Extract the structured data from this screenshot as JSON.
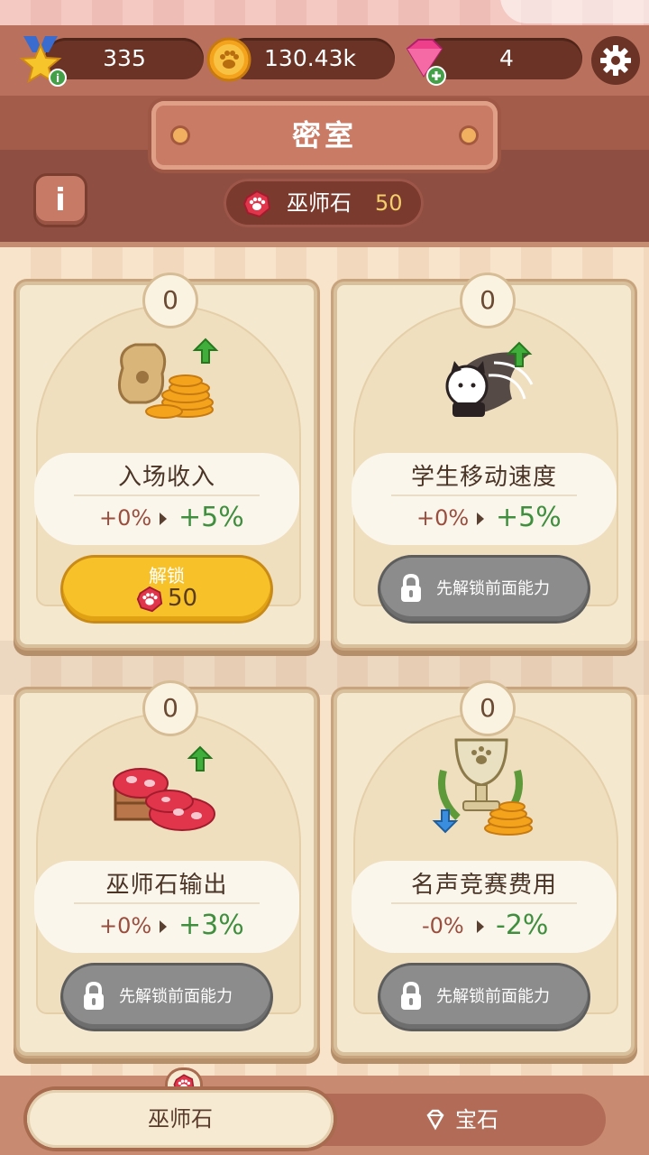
{
  "resources": {
    "level": "335",
    "coins": "130.43k",
    "gems": "4"
  },
  "title": "密室",
  "wizard_stone": {
    "label": "巫师石",
    "count": "50"
  },
  "cards": [
    {
      "name": "入场收入",
      "level": "0",
      "old_value": "+0%",
      "new_value": "+5%",
      "button": {
        "type": "unlock",
        "label": "解锁",
        "cost": "50"
      },
      "trend": "up",
      "icon": "coin-bag-icon"
    },
    {
      "name": "学生移动速度",
      "level": "0",
      "old_value": "+0%",
      "new_value": "+5%",
      "button": {
        "type": "locked",
        "label": "先解锁前面能力"
      },
      "trend": "up",
      "icon": "running-cat-icon"
    },
    {
      "name": "巫师石输出",
      "level": "0",
      "old_value": "+0%",
      "new_value": "+3%",
      "button": {
        "type": "locked",
        "label": "先解锁前面能力"
      },
      "trend": "up",
      "icon": "wizard-stone-pile-icon"
    },
    {
      "name": "名声竞赛费用",
      "level": "0",
      "old_value": "-0%",
      "new_value": "-2%",
      "button": {
        "type": "locked",
        "label": "先解锁前面能力"
      },
      "trend": "down",
      "icon": "trophy-icon"
    }
  ],
  "tabs": [
    {
      "label": "巫师石",
      "active": true
    },
    {
      "label": "宝石",
      "active": false
    }
  ],
  "colors": {
    "up_arrow": "#3fae3a",
    "down_arrow": "#3a8ee0",
    "gain_text": "#3f8f3e"
  }
}
